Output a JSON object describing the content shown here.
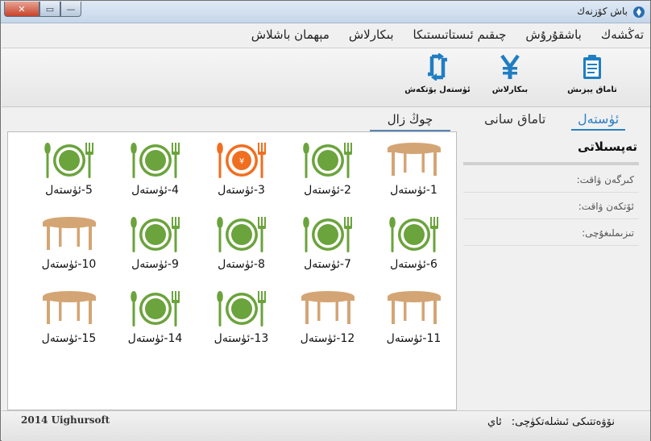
{
  "window": {
    "title": "باش كۆزنەك",
    "controls": {
      "close": "✕",
      "maximize": "▭",
      "minimize": "—"
    }
  },
  "menu": [
    "مېھمان باشلاش",
    "بىكارلاش",
    "چىقىم ئىستاتىستىكا",
    "باشقۇرۇش",
    "تەڭشەك"
  ],
  "toolbar": {
    "buttons": [
      {
        "label": "تاماق يېزىش",
        "icon": "clipboard-icon"
      },
      {
        "label": "بىكارلاش",
        "icon": "yen-icon"
      },
      {
        "label": "ئۈستەل يۆتكەش",
        "icon": "swap-arrows-icon"
      }
    ]
  },
  "left_tab": "چوڭ زال",
  "right_tabs": {
    "active": "ئۈستەل",
    "inactive": "تاماق سانى"
  },
  "tables": [
    {
      "label": "1-ئۈستەل",
      "state": "empty"
    },
    {
      "label": "2-ئۈستەل",
      "state": "occupied"
    },
    {
      "label": "3-ئۈستەل",
      "state": "billing"
    },
    {
      "label": "4-ئۈستەل",
      "state": "occupied"
    },
    {
      "label": "5-ئۈستەل",
      "state": "occupied"
    },
    {
      "label": "6-ئۈستەل",
      "state": "occupied"
    },
    {
      "label": "7-ئۈستەل",
      "state": "occupied"
    },
    {
      "label": "8-ئۈستەل",
      "state": "occupied"
    },
    {
      "label": "9-ئۈستەل",
      "state": "occupied"
    },
    {
      "label": "10-ئۈستەل",
      "state": "empty"
    },
    {
      "label": "11-ئۈستەل",
      "state": "empty"
    },
    {
      "label": "12-ئۈستەل",
      "state": "empty"
    },
    {
      "label": "13-ئۈستەل",
      "state": "occupied"
    },
    {
      "label": "14-ئۈستەل",
      "state": "occupied"
    },
    {
      "label": "15-ئۈستەل",
      "state": "empty"
    }
  ],
  "details": {
    "heading": "تەپسىلاتى",
    "fields": [
      "كىرگەن ۋاقت:",
      "ئۆتكەن ۋاقت:",
      "تىزىملىغۇچى:"
    ]
  },
  "status": {
    "copyright": "2014 Uighursoft",
    "label": "نۆۋەتتىكى ئىشلەتكۈچى:",
    "value": "ئاي"
  },
  "colors": {
    "occupied": "#6ba33c",
    "billing": "#f06e1f",
    "empty": "#d4a574",
    "accent": "#2a7fc4"
  }
}
